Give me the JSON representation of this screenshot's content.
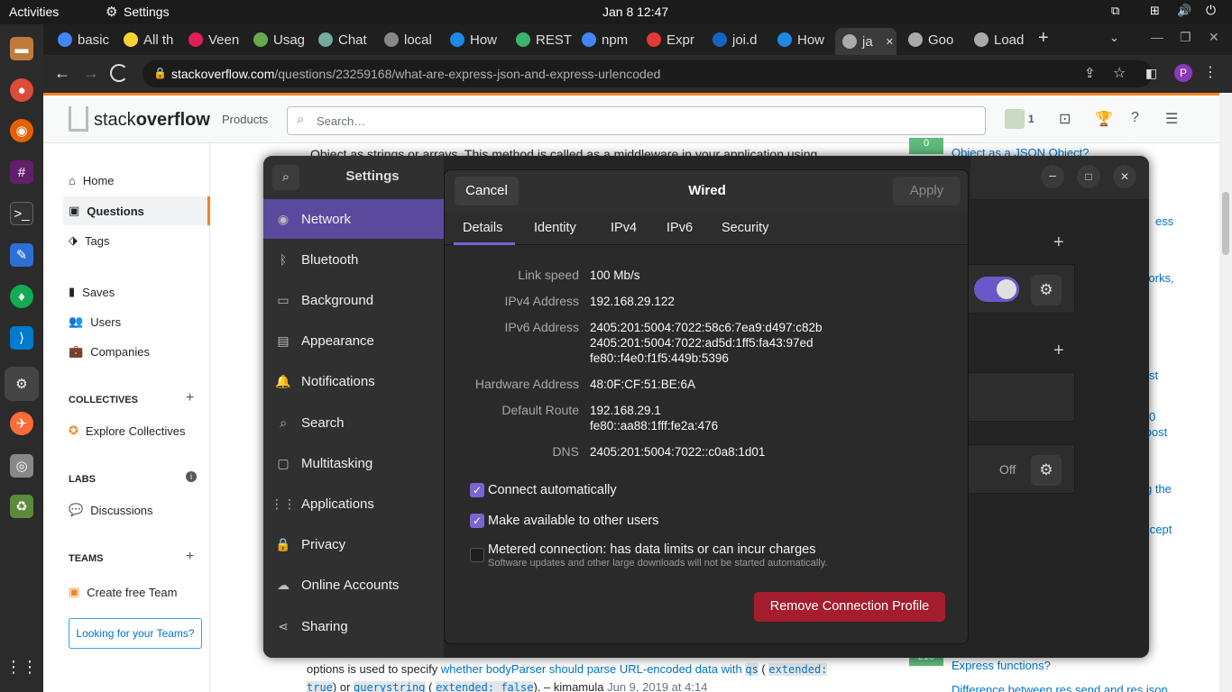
{
  "topbar": {
    "activities": "Activities",
    "app": "Settings",
    "clock": "Jan 8  12:47"
  },
  "tabs": [
    {
      "label": "basic",
      "color": "#4285f4"
    },
    {
      "label": "All th",
      "color": "#f7d334"
    },
    {
      "label": "Veen",
      "color": "#e01e5a"
    },
    {
      "label": "Usag",
      "color": "#6aa84f"
    },
    {
      "label": "Chat",
      "color": "#74aa9c"
    },
    {
      "label": "local",
      "color": "#888888"
    },
    {
      "label": "How",
      "color": "#1e88e5"
    },
    {
      "label": "REST",
      "color": "#3cb371"
    },
    {
      "label": "npm",
      "color": "#4285f4"
    },
    {
      "label": "Expr",
      "color": "#e53935"
    },
    {
      "label": "joi.d",
      "color": "#1565c0"
    },
    {
      "label": "How",
      "color": "#1e88e5"
    },
    {
      "label": "ja",
      "color": "#aaaaaa"
    },
    {
      "label": "Goo",
      "color": "#aaaaaa"
    },
    {
      "label": "Load",
      "color": "#aaaaaa"
    }
  ],
  "address": {
    "host": "stackoverflow.com",
    "path": "/questions/23259168/what-are-express-json-and-express-urlencoded"
  },
  "so": {
    "logo_a": "stack",
    "logo_b": "overflow",
    "products": "Products",
    "search_placeholder": "Search…",
    "rep": "1",
    "nav": {
      "home": "Home",
      "questions": "Questions",
      "tags": "Tags",
      "saves": "Saves",
      "users": "Users",
      "companies": "Companies"
    },
    "collectives": "COLLECTIVES",
    "explore": "Explore Collectives",
    "labs": "LABS",
    "discussions": "Discussions",
    "teams": "TEAMS",
    "create_team": "Create free Team",
    "looking": "Looking for your Teams?",
    "bg_top": "Object as strings or arrays. This method is called as a middleware in your application using",
    "bg_b1": "options is used to specify ",
    "bg_b2": "whether bodyParser should parse URL-encoded data with",
    "bg_b3": "qs",
    "bg_b4": "extended:",
    "bg_b5": "true",
    "bg_b6": ") or ",
    "bg_b7": "querystring",
    "bg_b8": "extended: false",
    "bg_b9": "). – kimamula",
    "bg_b10": "Jun 9, 2019 at 4:14",
    "right_links": [
      "Object as a JSON Object?",
      "ess",
      "works,",
      "st",
      "0",
      ".post",
      "g the",
      "accept",
      "Express functions?",
      "Difference between res.send and res.json"
    ],
    "score_top": "0",
    "score_bottom": "216"
  },
  "settings": {
    "title": "Settings",
    "items": [
      "Network",
      "Bluetooth",
      "Background",
      "Appearance",
      "Notifications",
      "Search",
      "Multitasking",
      "Applications",
      "Privacy",
      "Online Accounts",
      "Sharing"
    ],
    "off_label": "Off"
  },
  "dialog": {
    "cancel": "Cancel",
    "title": "Wired",
    "apply": "Apply",
    "tabs": [
      "Details",
      "Identity",
      "IPv4",
      "IPv6",
      "Security"
    ],
    "rows": [
      {
        "label": "Link speed",
        "value": "100 Mb/s"
      },
      {
        "label": "IPv4 Address",
        "value": "192.168.29.122"
      },
      {
        "label": "IPv6 Address",
        "value": "2405:201:5004:7022:58c6:7ea9:d497:c82b\n2405:201:5004:7022:ad5d:1ff5:fa43:97ed\nfe80::f4e0:f1f5:449b:5396"
      },
      {
        "label": "Hardware Address",
        "value": "48:0F:CF:51:BE:6A"
      },
      {
        "label": "Default Route",
        "value": "192.168.29.1\nfe80::aa88:1fff:fe2a:476"
      },
      {
        "label": "DNS",
        "value": "2405:201:5004:7022::c0a8:1d01"
      }
    ],
    "connect_auto": "Connect automatically",
    "make_available": "Make available to other users",
    "metered": "Metered connection: has data limits or can incur charges",
    "metered_sub": "Software updates and other large downloads will not be started automatically.",
    "remove": "Remove Connection Profile"
  }
}
